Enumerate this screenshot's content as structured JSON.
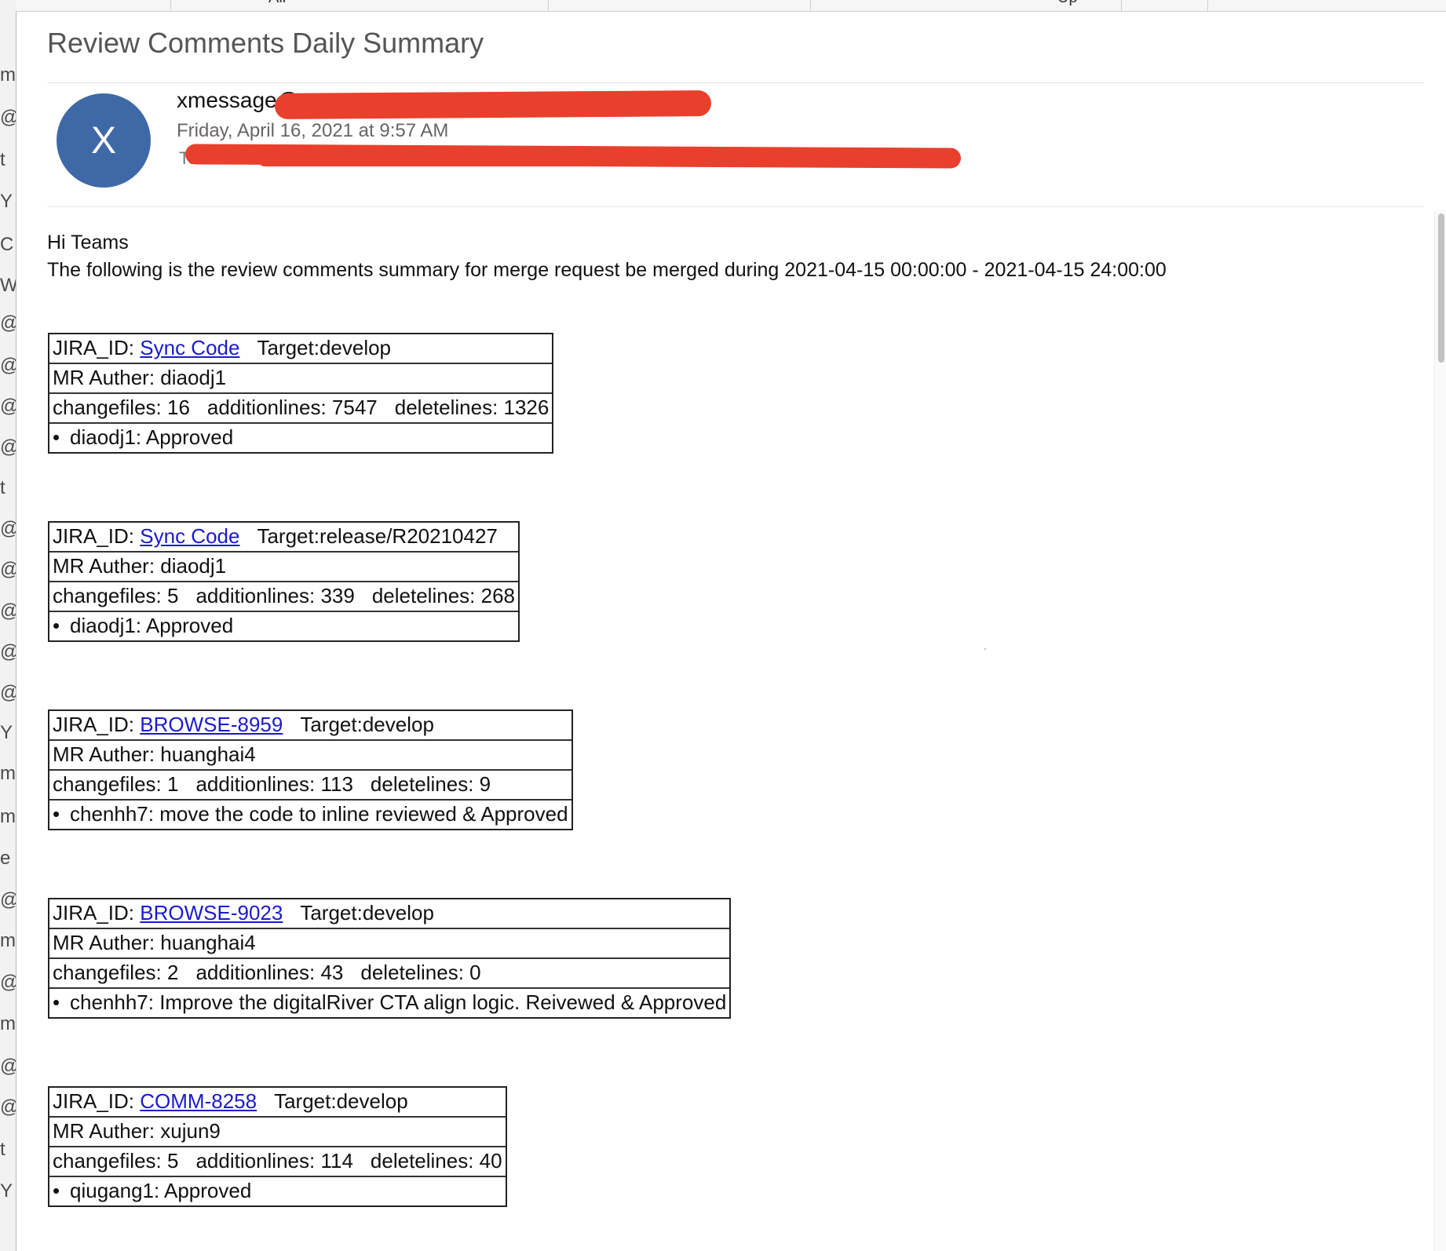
{
  "subject": "Review Comments Daily Summary",
  "sender": {
    "avatar_letter": "X",
    "from": "xmessage@",
    "date": "Friday, April 16, 2021 at 9:57 AM",
    "to_label": "To:"
  },
  "body": {
    "greeting": "Hi Teams",
    "intro": "The following is the review comments summary for merge request be merged during 2021-04-15 00:00:00 - 2021-04-15 24:00:00"
  },
  "merge_requests": [
    {
      "jira_label": "JIRA_ID:",
      "jira_link": "Sync Code",
      "target": "Target:develop",
      "author": "MR Auther: diaodj1",
      "changefiles": "changefiles: 16",
      "additionlines": "additionlines: 7547",
      "deletelines": "deletelines: 1326",
      "bullet": "•",
      "comment": "diaodj1: Approved"
    },
    {
      "jira_label": "JIRA_ID:",
      "jira_link": "Sync Code",
      "target": "Target:release/R20210427",
      "author": "MR Auther: diaodj1",
      "changefiles": "changefiles: 5",
      "additionlines": "additionlines: 339",
      "deletelines": "deletelines: 268",
      "bullet": "•",
      "comment": "diaodj1: Approved"
    },
    {
      "jira_label": "JIRA_ID:",
      "jira_link": "BROWSE-8959",
      "target": "Target:develop",
      "author": "MR Auther: huanghai4",
      "changefiles": "changefiles: 1",
      "additionlines": "additionlines: 113",
      "deletelines": "deletelines: 9",
      "bullet": "•",
      "comment": "chenhh7: move the code to inline reviewed & Approved"
    },
    {
      "jira_label": "JIRA_ID:",
      "jira_link": "BROWSE-9023",
      "target": "Target:develop",
      "author": "MR Auther: huanghai4",
      "changefiles": "changefiles: 2",
      "additionlines": "additionlines: 43",
      "deletelines": "deletelines: 0",
      "bullet": "•",
      "comment": "chenhh7: Improve the digitalRiver CTA align logic. Reivewed & Approved"
    },
    {
      "jira_label": "JIRA_ID:",
      "jira_link": "COMM-8258",
      "target": "Target:develop",
      "author": "MR Auther: xujun9",
      "changefiles": "changefiles: 5",
      "additionlines": "additionlines: 114",
      "deletelines": "deletelines: 40",
      "bullet": "•",
      "comment": "qiugang1: Approved"
    }
  ],
  "background_list_fragments": [
    "m",
    "@",
    "t",
    "Y",
    "C",
    "W",
    "@",
    "@",
    "@",
    "@",
    "t",
    "@",
    "@",
    "@",
    "@",
    "@",
    "Y",
    "m",
    "m",
    "e",
    "@",
    "m",
    "@",
    "m",
    "@",
    "@",
    "t",
    "Y"
  ],
  "top_band_fragments": [
    "All",
    "Up"
  ],
  "colors": {
    "avatar": "#3f69a6",
    "link": "#1a1ad0",
    "redaction": "#e8402c"
  }
}
